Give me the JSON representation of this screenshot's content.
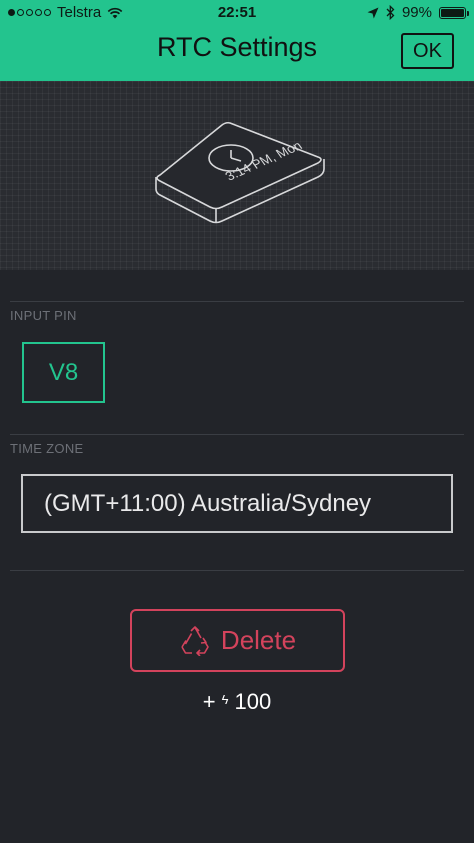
{
  "status_bar": {
    "carrier": "Telstra",
    "time": "22:51",
    "battery_percent": "99%",
    "battery_level": 0.99,
    "signal_bars_filled": 1,
    "signal_bars_total": 5,
    "icons": [
      "wifi-icon",
      "location-arrow-icon",
      "bluetooth-icon",
      "battery-icon"
    ]
  },
  "nav": {
    "title": "RTC Settings",
    "ok_label": "OK"
  },
  "illustration": {
    "device_text": "3:14 PM, Mon",
    "icon": "clock-icon"
  },
  "input_pin": {
    "label": "INPUT PIN",
    "value": "V8"
  },
  "time_zone": {
    "label": "TIME ZONE",
    "value": "(GMT+11:00) Australia/Sydney"
  },
  "delete": {
    "label": "Delete",
    "icon": "recycle-icon"
  },
  "energy": {
    "prefix": "+",
    "icon": "lightning-bolt-icon",
    "amount": "100"
  },
  "colors": {
    "accent": "#23C48E",
    "background": "#222429",
    "danger": "#D3435C",
    "text": "#E9E9EA",
    "muted": "#6D7077"
  }
}
